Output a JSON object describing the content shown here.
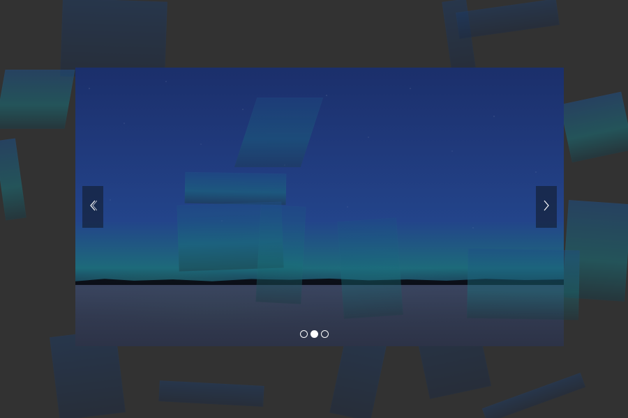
{
  "slider": {
    "current_slide": 2,
    "total_slides": 3,
    "bullets": [
      {
        "active": false
      },
      {
        "active": true
      },
      {
        "active": false
      }
    ],
    "controls": {
      "prev_icon": "chevron-left-icon",
      "next_icon": "chevron-right-icon"
    },
    "colors": {
      "background": "#323232",
      "bullet": "#ffffff",
      "arrow_bg": "#141e32"
    }
  }
}
